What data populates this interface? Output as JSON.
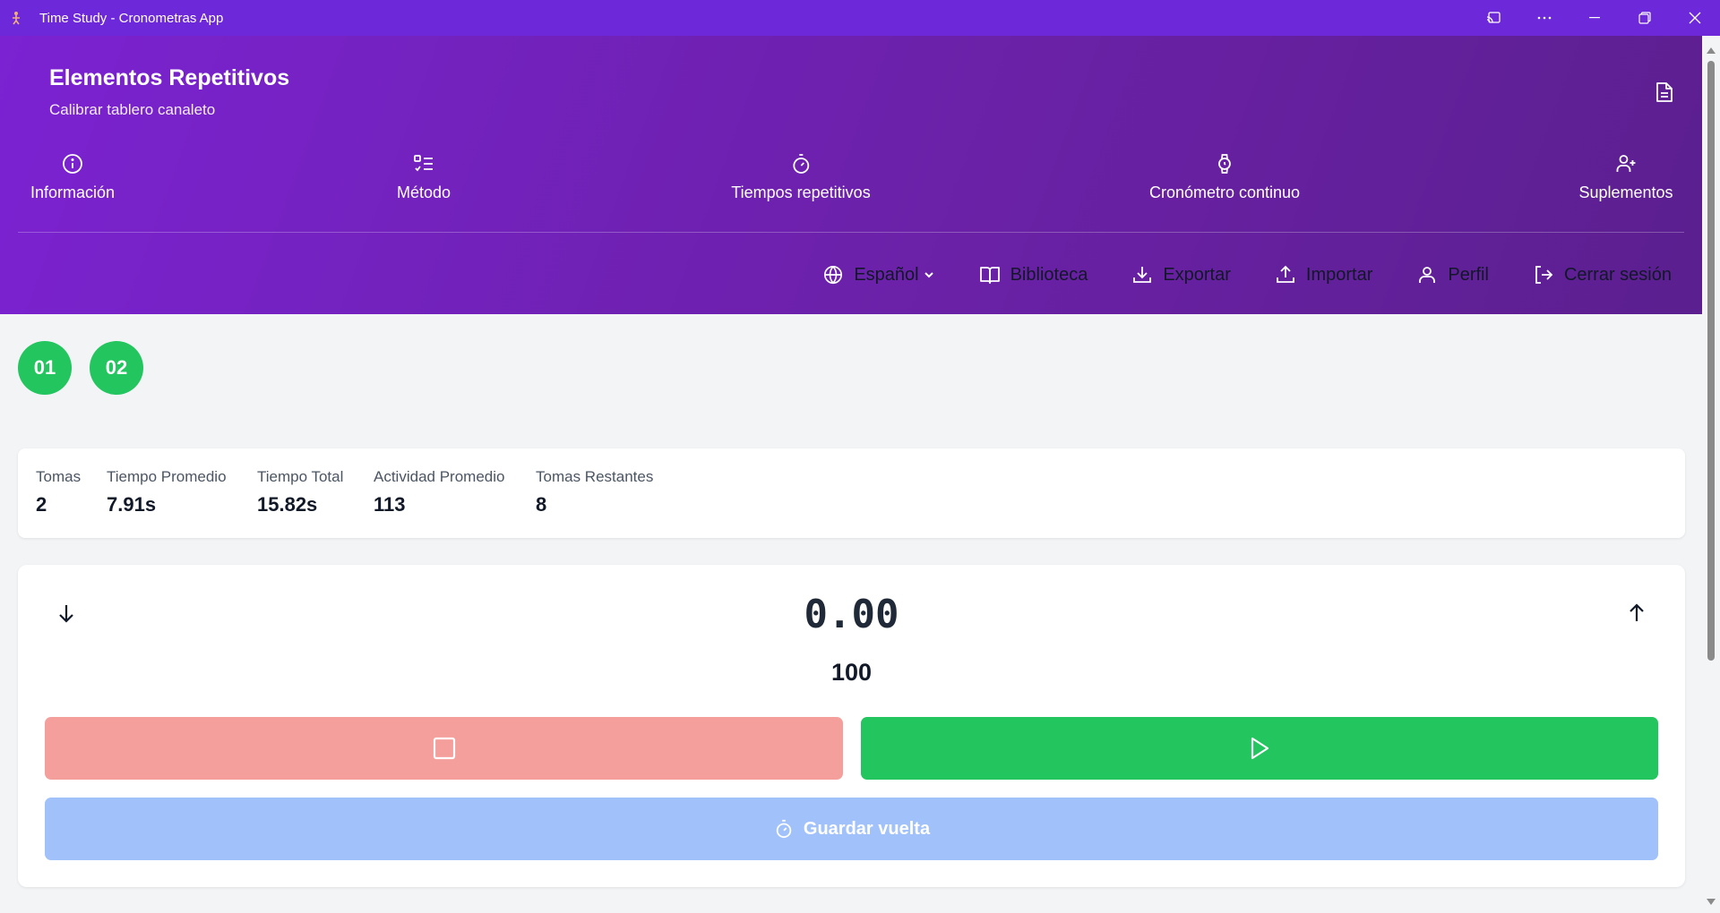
{
  "window": {
    "title": "Time Study - Cronometras App"
  },
  "header": {
    "title": "Elementos Repetitivos",
    "subtitle": "Calibrar tablero canaleto"
  },
  "nav": [
    {
      "label": "Información",
      "icon": "info-icon"
    },
    {
      "label": "Método",
      "icon": "list-check-icon"
    },
    {
      "label": "Tiempos repetitivos",
      "icon": "stopwatch-icon"
    },
    {
      "label": "Cronómetro continuo",
      "icon": "watch-icon"
    },
    {
      "label": "Suplementos",
      "icon": "user-plus-icon"
    }
  ],
  "toolbar": {
    "language": "Español",
    "library": "Biblioteca",
    "export": "Exportar",
    "import": "Importar",
    "profile": "Perfil",
    "logout": "Cerrar sesión"
  },
  "chips": [
    "01",
    "02"
  ],
  "stats": [
    {
      "label": "Tomas",
      "value": "2"
    },
    {
      "label": "Tiempo Promedio",
      "value": "7.91s"
    },
    {
      "label": "Tiempo Total",
      "value": "15.82s"
    },
    {
      "label": "Actividad Promedio",
      "value": "113"
    },
    {
      "label": "Tomas Restantes",
      "value": "8"
    }
  ],
  "timer": {
    "display": "0.00",
    "activity": "100",
    "lap_label": "Guardar vuelta"
  },
  "colors": {
    "titlebar": "#6d28d9",
    "header": "#7b22d2",
    "success": "#22c55e",
    "stop": "#f59f9c",
    "lap": "#a0c1fa"
  }
}
